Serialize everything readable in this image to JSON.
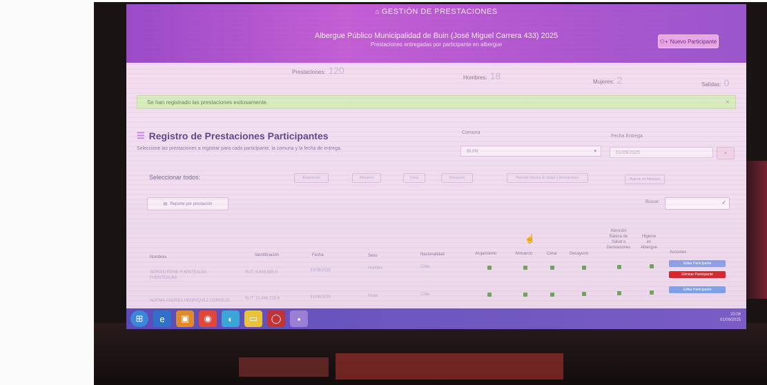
{
  "header": {
    "title": "GESTIÓN DE PRESTACIONES",
    "subtitle": "Albergue Público Municipalidad de Buin (José Miguel Carrera 433) 2025",
    "subtitle2": "Prestaciones entregadas por participante en albergue",
    "new_participant_label": "Nuevo Participante"
  },
  "stats": {
    "prestaciones_label": "Prestaciones:",
    "prestaciones_value": "120",
    "hombres_label": "Hombres:",
    "hombres_value": "18",
    "mujeres_label": "Mujeres:",
    "mujeres_value": "2",
    "salidas_label": "Salidas:",
    "salidas_value": "0"
  },
  "alert": {
    "message": "Se han registrado las prestaciones exitosamente.",
    "close": "×"
  },
  "section": {
    "title": "Registro de Prestaciones Participantes",
    "help": "Seleccione las prestaciones a registrar para cada participante, la comuna y la fecha de entrega."
  },
  "form": {
    "comuna_label": "Comuna",
    "comuna_value": "BUIN",
    "fecha_label": "Fecha Entrega",
    "fecha_value": "01/09/2025"
  },
  "select_all": {
    "label": "Seleccionar todos:",
    "filters": [
      "Alojamiento",
      "Almuerzo",
      "Cena",
      "Desayuno",
      "Atención Básica de Salud o Derivaciones",
      "Higiene en Albergue"
    ]
  },
  "report_button": "Reporte por prestación",
  "search": {
    "label": "Buscar:"
  },
  "table": {
    "headers": {
      "nombres": "Nombres",
      "identificacion": "Identificación",
      "fecha": "Fecha",
      "sexo": "Sexo",
      "nacionalidad": "Nacionalidad",
      "alojamiento": "Alojamiento",
      "almuerzo": "Almuerzo",
      "cena": "Cena",
      "desayuno": "Desayuno",
      "atencion_1": "Atención",
      "atencion_2": "Básica de",
      "atencion_3": "Salud o",
      "atencion_4": "Derivaciones",
      "higiene_1": "Higiene",
      "higiene_2": "en",
      "higiene_3": "Albergue",
      "acciones": "Acciones"
    },
    "rows": [
      {
        "nombre": "SERGIO RENE FUENTEALBA FUENTEALBA",
        "id": "RUT: 9.859.830-0",
        "fecha": "31/08/2025",
        "sexo": "Hombre",
        "nacionalidad": "Chile",
        "btn1": "Editar Participante",
        "btn2": "Eliminar Participante"
      },
      {
        "nombre": "NORMA ANDREA HENRIQUEZ CORNEJO",
        "id": "RUT: 15.948.225-6",
        "fecha": "31/08/2025",
        "sexo": "Mujer",
        "nacionalidad": "Chile",
        "btn1": "Editar Participante"
      }
    ]
  },
  "tray": {
    "time": "20:08",
    "date": "01/09/2025"
  },
  "colors": {
    "header_bg": "#b258d0",
    "alert_bg": "#d9ecc0",
    "btn_blue": "#8fa0e6",
    "btn_red": "#d8282f",
    "check_green": "#6fa35e"
  }
}
